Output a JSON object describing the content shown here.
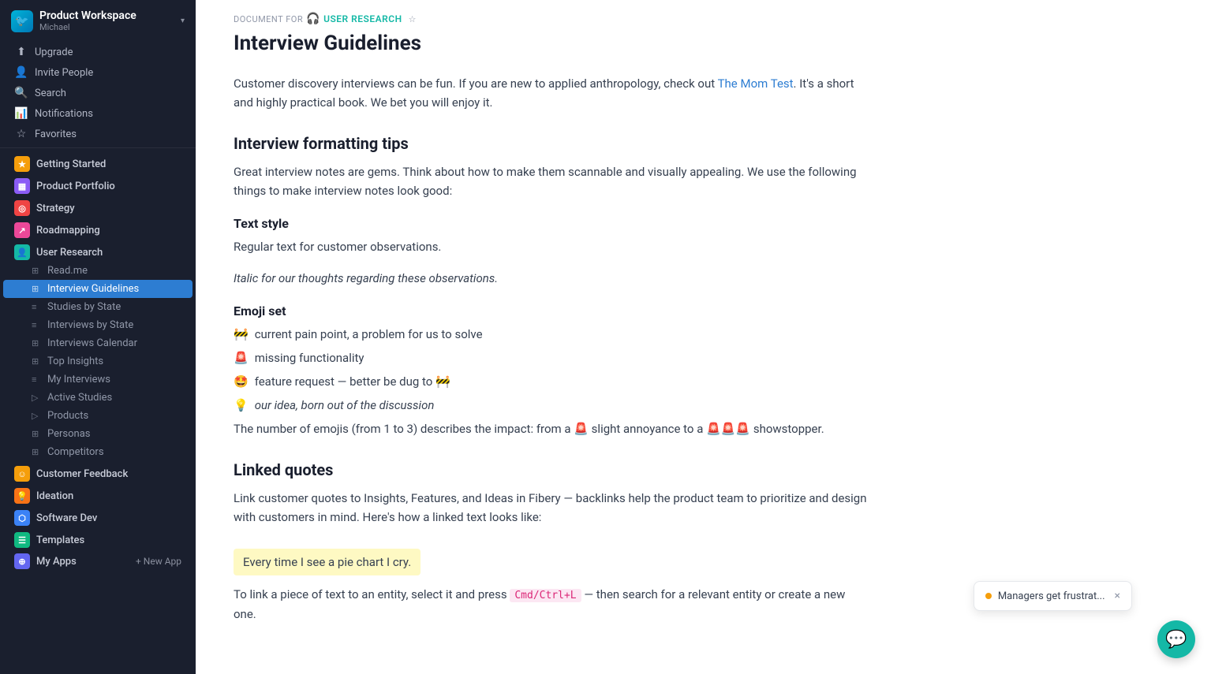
{
  "workspace": {
    "name": "Product Workspace",
    "user": "Michael",
    "chevron": "▾"
  },
  "nav": {
    "upgrade": "Upgrade",
    "invite_people": "Invite People",
    "search": "Search",
    "notifications": "Notifications",
    "favorites": "Favorites"
  },
  "apps": [
    {
      "id": "getting-started",
      "label": "Getting Started",
      "icon_class": "icon-getting-started",
      "icon_text": "★"
    },
    {
      "id": "product-portfolio",
      "label": "Product Portfolio",
      "icon_class": "icon-product-portfolio",
      "icon_text": "▦"
    },
    {
      "id": "strategy",
      "label": "Strategy",
      "icon_class": "icon-strategy",
      "icon_text": "◎"
    },
    {
      "id": "roadmapping",
      "label": "Roadmapping",
      "icon_class": "icon-roadmapping",
      "icon_text": "↗"
    },
    {
      "id": "user-research",
      "label": "User Research",
      "icon_class": "icon-user-research",
      "icon_text": "👤",
      "subitems": [
        {
          "id": "read-me",
          "label": "Read.me",
          "icon": "⊞",
          "active": false
        },
        {
          "id": "interview-guidelines",
          "label": "Interview Guidelines",
          "icon": "⊞",
          "active": true
        },
        {
          "id": "studies-by-state",
          "label": "Studies by State",
          "icon": "≡≡",
          "active": false
        },
        {
          "id": "interviews-by-state",
          "label": "Interviews by State",
          "icon": "≡≡",
          "active": false
        },
        {
          "id": "interviews-calendar",
          "label": "Interviews Calendar",
          "icon": "⊞",
          "active": false
        },
        {
          "id": "top-insights",
          "label": "Top Insights",
          "icon": "⊞",
          "active": false
        },
        {
          "id": "my-interviews",
          "label": "My Interviews",
          "icon": "≡≡",
          "active": false
        },
        {
          "id": "active-studies",
          "label": "Active Studies",
          "icon": "▷",
          "active": false
        },
        {
          "id": "products",
          "label": "Products",
          "icon": "▷",
          "active": false
        },
        {
          "id": "personas",
          "label": "Personas",
          "icon": "⊞",
          "active": false
        },
        {
          "id": "competitors",
          "label": "Competitors",
          "icon": "⊞",
          "active": false
        }
      ]
    },
    {
      "id": "customer-feedback",
      "label": "Customer Feedback",
      "icon_class": "icon-customer-feedback",
      "icon_text": "☺"
    },
    {
      "id": "ideation",
      "label": "Ideation",
      "icon_class": "icon-ideation",
      "icon_text": "💡"
    },
    {
      "id": "software-dev",
      "label": "Software Dev",
      "icon_class": "icon-software-dev",
      "icon_text": "⬡"
    },
    {
      "id": "templates",
      "label": "Templates",
      "icon_class": "icon-templates",
      "icon_text": "☰"
    }
  ],
  "my_apps": {
    "label": "My Apps",
    "new_app_label": "+ New App"
  },
  "document": {
    "breadcrumb_for": "DOCUMENT FOR",
    "app_name": "USER RESEARCH",
    "title": "Interview Guidelines",
    "intro": "Customer discovery interviews can be fun. If you are new to applied anthropology, check out ",
    "link_text": "The Mom Test",
    "intro_end": ". It's a short and highly practical book. We bet you will enjoy it.",
    "section_formatting": "Interview formatting tips",
    "section_formatting_desc": "Great interview notes are gems. Think about how to make them scannable and visually appealing. We use the following things to make interview notes look good:",
    "section_text_style": "Text style",
    "regular_text": "Regular text for customer observations.",
    "italic_text": "Italic for our thoughts regarding these observations.",
    "section_emoji": "Emoji set",
    "emoji_items": [
      {
        "emoji": "🚧",
        "text": "current pain point, a problem for us to solve",
        "italic": false
      },
      {
        "emoji": "🚨",
        "text": "missing functionality",
        "italic": false
      },
      {
        "emoji": "🤩",
        "text": "feature request — better be dug to 🚧",
        "italic": false
      },
      {
        "emoji": "💡",
        "text": "our idea, born out of the discussion",
        "italic": true
      }
    ],
    "emoji_count_desc": "The number of emojis (from 1 to 3) describes the impact: from a 🚨 slight annoyance to a 🚨🚨🚨 showstopper.",
    "section_linked": "Linked quotes",
    "linked_desc": "Link customer quotes to Insights, Features, and Ideas in Fibery — backlinks help the product team to prioritize and design with customers in mind. Here's how a linked text looks like:",
    "highlighted_quote": "Every time I see a pie chart I cry.",
    "linked_instructions": "To link a piece of text to an entity, select it and press ",
    "shortcut": "Cmd/Ctrl+L",
    "linked_instructions_end": " — then search for a relevant entity or create a new one."
  },
  "options_icon": "···",
  "toast": {
    "text": "Managers get frustrat...",
    "close": "×"
  },
  "chat_icon": "💬"
}
